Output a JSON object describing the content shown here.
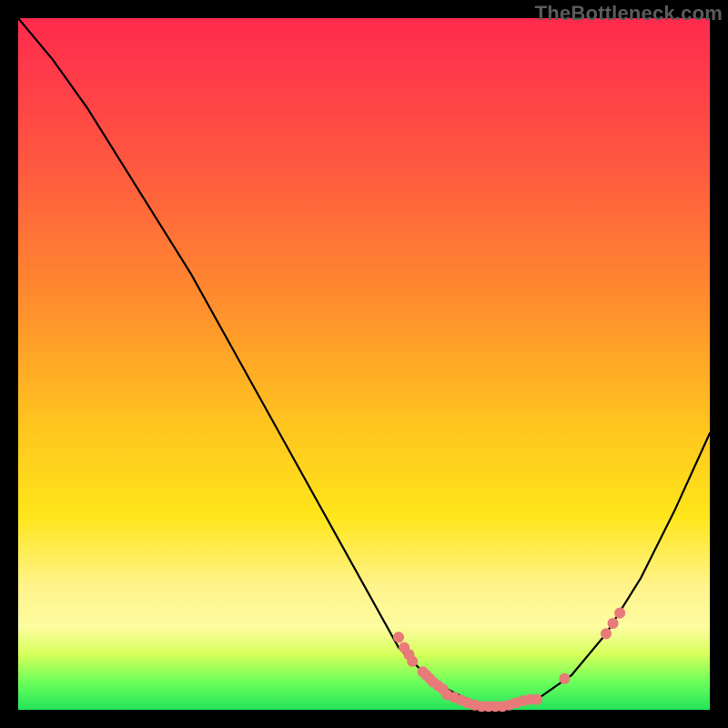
{
  "watermark": "TheBottleneck.com",
  "colors": {
    "curve_stroke": "#000000",
    "dot_fill": "#e87a7a",
    "background_black": "#000000"
  },
  "chart_data": {
    "type": "line",
    "title": "",
    "xlabel": "",
    "ylabel": "",
    "xlim": [
      0,
      100
    ],
    "ylim": [
      0,
      100
    ],
    "grid": false,
    "legend": false,
    "series": [
      {
        "name": "bottleneck-curve",
        "x": [
          0,
          5,
          10,
          15,
          20,
          25,
          30,
          35,
          40,
          45,
          50,
          55,
          56,
          60,
          65,
          68,
          70,
          75,
          80,
          85,
          90,
          95,
          100
        ],
        "y": [
          100,
          94,
          87,
          79,
          71,
          63,
          54,
          45,
          36,
          27,
          18,
          9,
          8,
          4,
          1.5,
          0.5,
          0.5,
          1.5,
          5,
          11,
          19,
          29,
          40
        ]
      }
    ],
    "dot_clusters": [
      {
        "name": "left-cluster-upper",
        "points": [
          {
            "x": 55,
            "y": 10.5
          },
          {
            "x": 55.8,
            "y": 9
          },
          {
            "x": 56.5,
            "y": 8
          },
          {
            "x": 57,
            "y": 7
          }
        ]
      },
      {
        "name": "left-cluster-lower",
        "points": [
          {
            "x": 58.5,
            "y": 5.5
          },
          {
            "x": 59,
            "y": 5
          },
          {
            "x": 59.5,
            "y": 4.5
          },
          {
            "x": 60,
            "y": 4
          },
          {
            "x": 60.7,
            "y": 3.5
          },
          {
            "x": 61.4,
            "y": 3
          }
        ]
      },
      {
        "name": "bottom-trough",
        "points": [
          {
            "x": 62,
            "y": 2.2
          },
          {
            "x": 63,
            "y": 1.8
          },
          {
            "x": 64,
            "y": 1.4
          },
          {
            "x": 65,
            "y": 1
          },
          {
            "x": 66,
            "y": 0.7
          },
          {
            "x": 67,
            "y": 0.5
          },
          {
            "x": 68,
            "y": 0.5
          },
          {
            "x": 69,
            "y": 0.5
          },
          {
            "x": 70,
            "y": 0.5
          },
          {
            "x": 71,
            "y": 0.7
          },
          {
            "x": 72,
            "y": 1
          },
          {
            "x": 73,
            "y": 1.3
          },
          {
            "x": 74,
            "y": 1.5
          },
          {
            "x": 75,
            "y": 1.5
          }
        ]
      },
      {
        "name": "right-gap-point",
        "points": [
          {
            "x": 79,
            "y": 4.5
          }
        ]
      },
      {
        "name": "right-cluster",
        "points": [
          {
            "x": 85,
            "y": 11
          },
          {
            "x": 86,
            "y": 12.5
          },
          {
            "x": 87,
            "y": 14
          }
        ]
      }
    ]
  }
}
